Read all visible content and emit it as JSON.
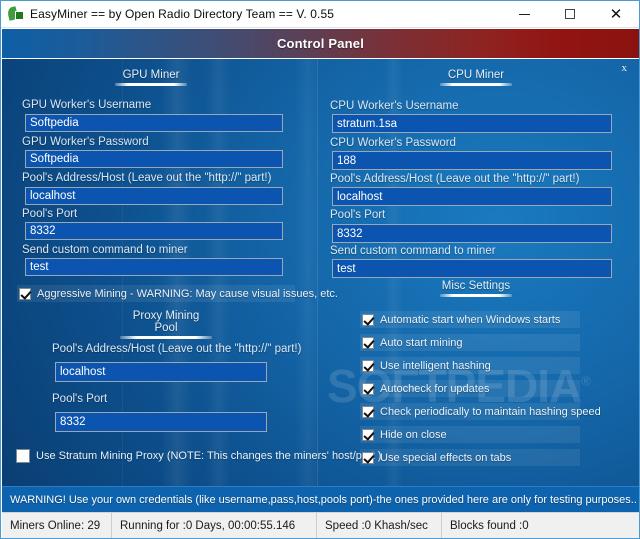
{
  "window": {
    "icon": "easyminer-leaf-icon",
    "title": "EasyMiner == by Open Radio Directory Team == V. 0.55",
    "controls": {
      "minimize": "minimize-icon",
      "maximize": "maximize-icon",
      "close": "close-icon"
    }
  },
  "header": {
    "title": "Control Panel",
    "gradient_from": "#0f5fa6",
    "gradient_to": "#8a1310",
    "close_link": "x"
  },
  "watermark": {
    "text": "SOFTPEDIA",
    "mark": "®"
  },
  "gpu_miner": {
    "section_title": "GPU Miner",
    "fields": [
      {
        "label": "GPU Worker's Username",
        "value": "Softpedia"
      },
      {
        "label": "GPU Worker's Password",
        "value": "Softpedia"
      },
      {
        "label": "Pool's Address/Host (Leave out the \"http://\" part!)",
        "value": "localhost"
      },
      {
        "label": "Pool's Port",
        "value": "8332"
      },
      {
        "label": "Send custom command to miner",
        "value": "test"
      }
    ],
    "aggressive": {
      "label": "Aggressive Mining - WARNING: May cause visual issues, etc.",
      "checked": true
    }
  },
  "proxy_pool": {
    "section_title": "Proxy Mining Pool",
    "fields": [
      {
        "label": "Pool's Address/Host (Leave out the \"http://\" part!)",
        "value": "localhost"
      },
      {
        "label": "Pool's Port",
        "value": "8332"
      }
    ],
    "use_proxy": {
      "label": "Use Stratum Mining Proxy (NOTE: This changes the miners' host/port )",
      "checked": false
    }
  },
  "cpu_miner": {
    "section_title": "CPU Miner",
    "fields": [
      {
        "label": "CPU Worker's Username",
        "value": "stratum.1sa"
      },
      {
        "label": "CPU Worker's Password",
        "value": "188"
      },
      {
        "label": "Pool's Address/Host (Leave out the \"http://\" part!)",
        "value": "localhost"
      },
      {
        "label": "Pool's Port",
        "value": "8332"
      },
      {
        "label": "Send custom command to miner",
        "value": "test"
      }
    ]
  },
  "misc_settings": {
    "section_title": "Misc Settings",
    "options": [
      {
        "label": "Automatic start when Windows starts",
        "checked": true
      },
      {
        "label": "Auto start mining",
        "checked": true
      },
      {
        "label": "Use intelligent hashing",
        "checked": true
      },
      {
        "label": "Autocheck for updates",
        "checked": true
      },
      {
        "label": "Check periodically to maintain hashing speed",
        "checked": true
      },
      {
        "label": "Hide on close",
        "checked": true
      },
      {
        "label": "Use special effects on tabs",
        "checked": true
      }
    ]
  },
  "warning": {
    "text": "WARNING! Use your own credentials (like username,pass,host,pools port)-the ones provided here are only for testing purposes.."
  },
  "statusbar": {
    "cells": [
      "Miners Online: 29",
      "Running for :0 Days, 00:00:55.146",
      "Speed :0 Khash/sec",
      "Blocks found :0"
    ]
  }
}
